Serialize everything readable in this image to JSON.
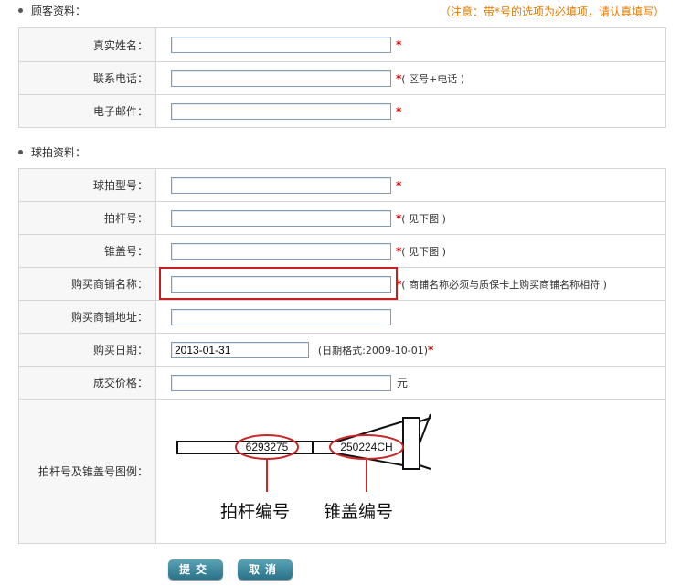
{
  "customer": {
    "section_title": "顾客资料：",
    "notice": "（注意：带*号的选项为必填项，请认真填写）",
    "fields": [
      {
        "label": "真实姓名：",
        "value": "",
        "required": "*",
        "note": ""
      },
      {
        "label": "联系电话：",
        "value": "",
        "required": "*",
        "note": "( 区号+电话 )"
      },
      {
        "label": "电子邮件：",
        "value": "",
        "required": "*",
        "note": ""
      }
    ]
  },
  "racket": {
    "section_title": "球拍资料：",
    "model": {
      "label": "球拍型号：",
      "value": "",
      "required": "*",
      "note": ""
    },
    "shaft": {
      "label": "拍杆号：",
      "value": "",
      "required": "*",
      "note": "( 见下图 )"
    },
    "cap": {
      "label": "锥盖号：",
      "value": "",
      "required": "*",
      "note": "( 见下图 )"
    },
    "store_name": {
      "label": "购买商铺名称：",
      "value": "",
      "required": "*",
      "note": "( 商铺名称必须与质保卡上购买商铺名称相符 )"
    },
    "store_address": {
      "label": "购买商铺地址：",
      "value": ""
    },
    "date": {
      "label": "购买日期：",
      "value": "2013-01-31",
      "note": "(日期格式:2009-10-01)",
      "required": "*"
    },
    "price": {
      "label": "成交价格：",
      "value": "",
      "unit": "元"
    },
    "example": {
      "label": "拍杆号及锥盖号图例：",
      "shaft_code": "6293275",
      "cap_code": "250224CH",
      "shaft_caption": "拍杆编号",
      "cap_caption": "锥盖编号"
    }
  },
  "buttons": {
    "submit": "提交",
    "cancel": "取消"
  },
  "colors": {
    "notice": "#e07a00",
    "required": "#c00000",
    "highlight": "#c81e1e",
    "button": "#2a7288"
  }
}
